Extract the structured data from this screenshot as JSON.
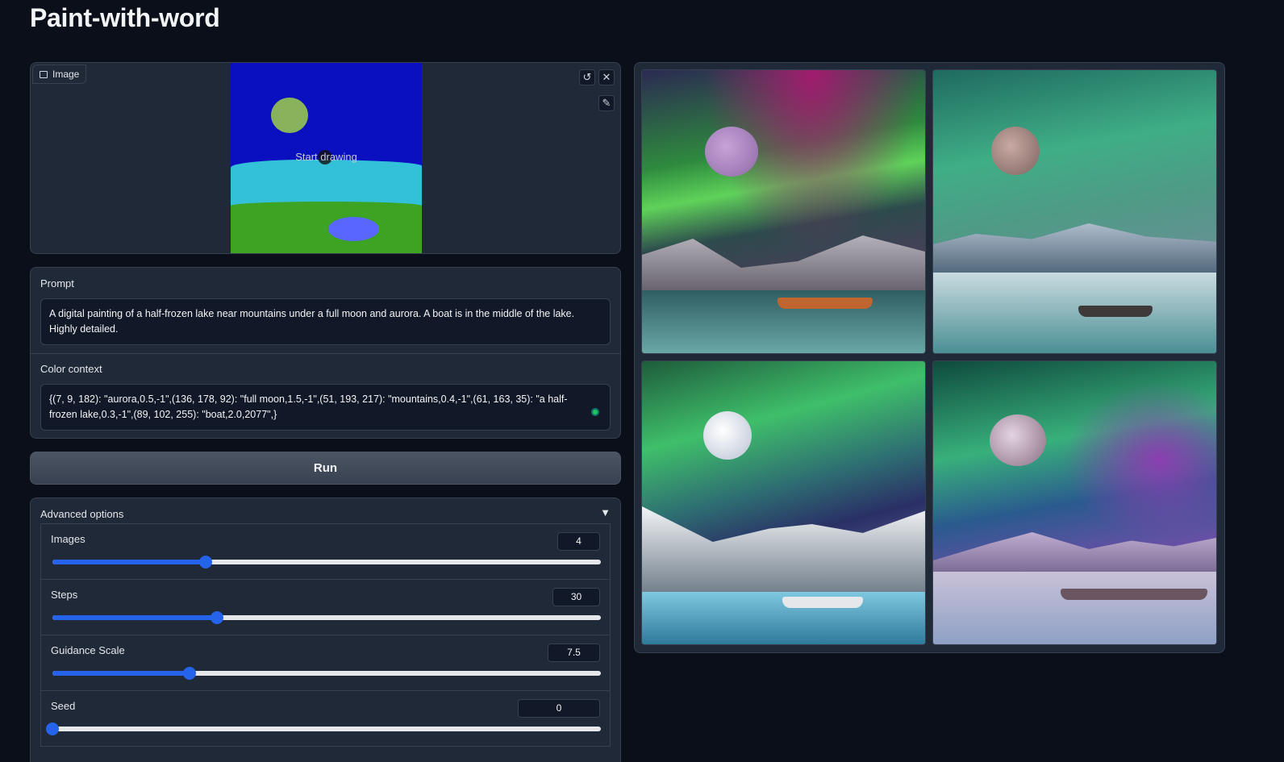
{
  "app": {
    "title": "Paint-with-word"
  },
  "image_input": {
    "label": "Image",
    "canvas_hint": "Start drawing",
    "undo_icon": "undo-icon",
    "clear_icon": "close-icon",
    "brush_icon": "brush-icon"
  },
  "prompt": {
    "label": "Prompt",
    "value": "A digital painting of a half-frozen lake near mountains under a full moon and aurora. A boat is in the middle of the lake. Highly detailed."
  },
  "color_context": {
    "label": "Color context",
    "value": "{(7, 9, 182): \"aurora,0.5,-1\",(136, 178, 92): \"full moon,1.5,-1\",(51, 193, 217): \"mountains,0.4,-1\",(61, 163, 35): \"a half-frozen lake,0.3,-1\",(89, 102, 255): \"boat,2.0,2077\",}"
  },
  "run_button": {
    "label": "Run"
  },
  "advanced": {
    "label": "Advanced options",
    "toggle": "▼",
    "sliders": [
      {
        "label": "Images",
        "value": "4",
        "fraction": 0.28
      },
      {
        "label": "Steps",
        "value": "30",
        "fraction": 0.3
      },
      {
        "label": "Guidance Scale",
        "value": "7.5",
        "fraction": 0.25
      },
      {
        "label": "Seed",
        "value": "0",
        "fraction": 0.0
      }
    ]
  },
  "gallery": {
    "count": 4,
    "colors": {
      "accent": "#2563eb",
      "panel": "#1f2937",
      "background": "#0b0f19"
    }
  }
}
